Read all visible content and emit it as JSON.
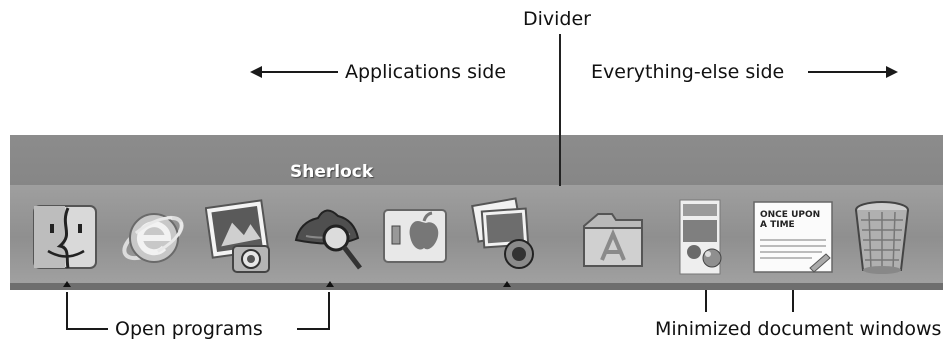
{
  "labels": {
    "divider": "Divider",
    "applications_side": "Applications side",
    "everything_else_side": "Everything-else side",
    "open_programs": "Open programs",
    "minimized_windows": "Minimized document windows"
  },
  "dock": {
    "tooltip": "Sherlock",
    "applications": [
      {
        "icon": "finder-icon",
        "running": true
      },
      {
        "icon": "internet-explorer-icon",
        "running": false
      },
      {
        "icon": "iphoto-icon",
        "running": false
      },
      {
        "icon": "sherlock-icon",
        "running": true
      },
      {
        "icon": "system-preferences-icon",
        "running": false
      },
      {
        "icon": "image-capture-icon",
        "running": true
      }
    ],
    "documents": [
      {
        "icon": "applications-folder-icon"
      },
      {
        "icon": "minimized-window-photo-icon"
      },
      {
        "icon": "minimized-window-text-icon",
        "text": "ONCE UPON A TIME"
      },
      {
        "icon": "trash-icon"
      }
    ]
  }
}
